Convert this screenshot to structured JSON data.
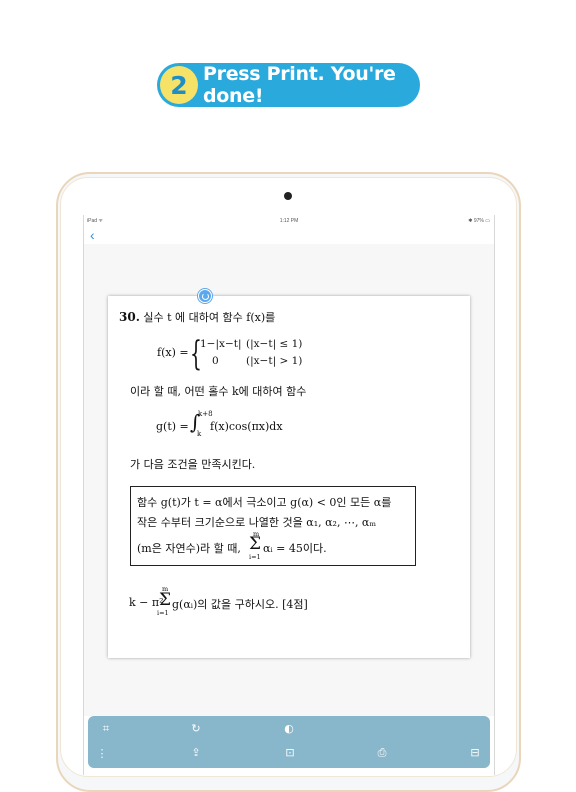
{
  "headline": {
    "step_number": "2",
    "text": "Press Print. You're done!",
    "accent_color": "#2aa9dd",
    "badge_color": "#f6e266"
  },
  "status_bar": {
    "left": "iPad ᯤ",
    "time": "1:12 PM",
    "right": "✱ 97% ▭"
  },
  "nav": {
    "back_icon": "chevron-left-icon",
    "back_glyph": "‹"
  },
  "problem": {
    "number": "30.",
    "intro": "실수 t 에 대하여 함수 f(x)를",
    "f_label": "f(x) =",
    "case1_expr": "1−|x−t|",
    "case1_cond": "(|x−t| ≤ 1)",
    "case2_expr": "0",
    "case2_cond": "(|x−t| > 1)",
    "line2": "이라 할 때, 어떤 홀수 k에 대하여 함수",
    "g_def": "g(t) =",
    "integral": "∫",
    "int_upper": "k+8",
    "int_lower": "k",
    "integrand": "f(x)cos(πx)dx",
    "line3": "가 다음 조건을 만족시킨다.",
    "box_line1": "함수 g(t)가 t = α에서 극소이고 g(α) < 0인 모든 α를",
    "box_line2": "작은 수부터 크기순으로 나열한 것을 α₁, α₂, ⋯, αₘ",
    "box_line3_pre": "(m은 자연수)라 할 때,",
    "box_sigma": "Σ",
    "box_sigma_upper": "m",
    "box_sigma_lower": "i=1",
    "box_sigma_body": "αᵢ = 45이다.",
    "final_pre": "k − π²",
    "final_sigma": "Σ",
    "final_sigma_upper": "m",
    "final_sigma_lower": "i=1",
    "final_post": "g(αᵢ)의 값을 구하시오. [4점]"
  },
  "toolbar": {
    "color": "#88b6cb",
    "icons": [
      {
        "name": "crop-icon",
        "glyph": "⌗"
      },
      {
        "name": "rotate-icon",
        "glyph": "↻"
      },
      {
        "name": "contrast-icon",
        "glyph": "◐"
      },
      {
        "name": "more-icon",
        "glyph": "⋮"
      },
      {
        "name": "share-icon",
        "glyph": "⇪"
      },
      {
        "name": "scan-icon",
        "glyph": "⊡"
      },
      {
        "name": "print-icon",
        "glyph": "⎙"
      },
      {
        "name": "tray-icon",
        "glyph": "⊟"
      }
    ]
  }
}
